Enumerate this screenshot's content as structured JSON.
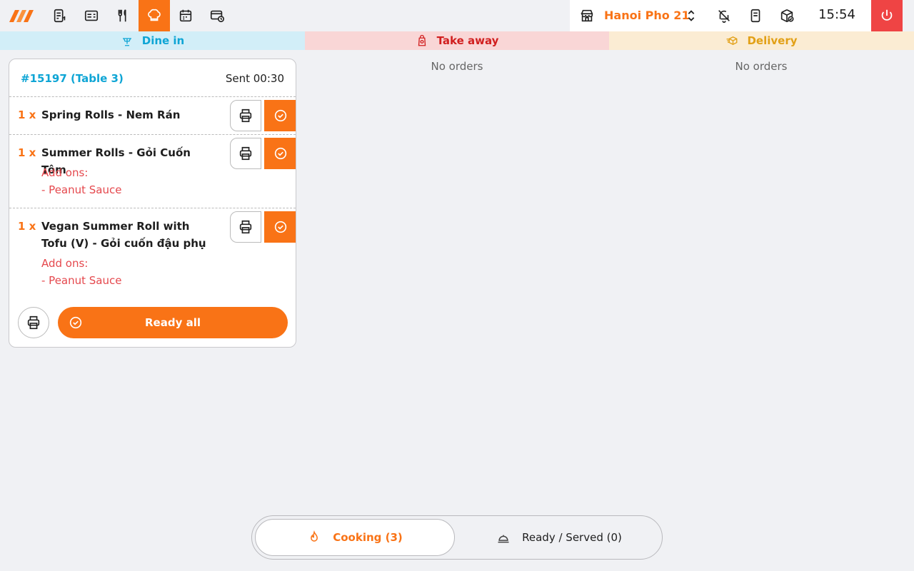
{
  "topbar": {
    "nav_icons": [
      "kitchen-logo-icon",
      "order-list-icon",
      "menu-list-icon",
      "cutlery-icon",
      "chef-hat-icon",
      "calendar-icon",
      "card-clock-icon"
    ],
    "active_nav": "chef-hat-icon",
    "store_name": "Hanoi Pho 21",
    "clock": "15:54",
    "accent_color": "#f97316",
    "power_color": "#ef4444"
  },
  "categories": {
    "dine_in": "Dine in",
    "take_away": "Take away",
    "delivery": "Delivery"
  },
  "columns": {
    "take_away_empty": "No orders",
    "delivery_empty": "No orders"
  },
  "order": {
    "id": "#15197 (Table 3)",
    "sent": "Sent 00:30",
    "items": [
      {
        "qty": "1 x",
        "name": "Spring Rolls - Nem Rán",
        "addons_label": "",
        "addons": []
      },
      {
        "qty": "1 x",
        "name": "Summer Rolls - Gỏi Cuốn Tôm",
        "addons_label": "Add ons:",
        "addons": [
          "- Peanut Sauce"
        ]
      },
      {
        "qty": "1 x",
        "name": "Vegan Summer Roll with Tofu (V) - Gỏi cuốn đậu phụ",
        "addons_label": "Add ons:",
        "addons": [
          "- Peanut Sauce"
        ]
      }
    ],
    "ready_all_label": "Ready all"
  },
  "bottom": {
    "cooking": "Cooking (3)",
    "ready_served": "Ready / Served (0)"
  }
}
